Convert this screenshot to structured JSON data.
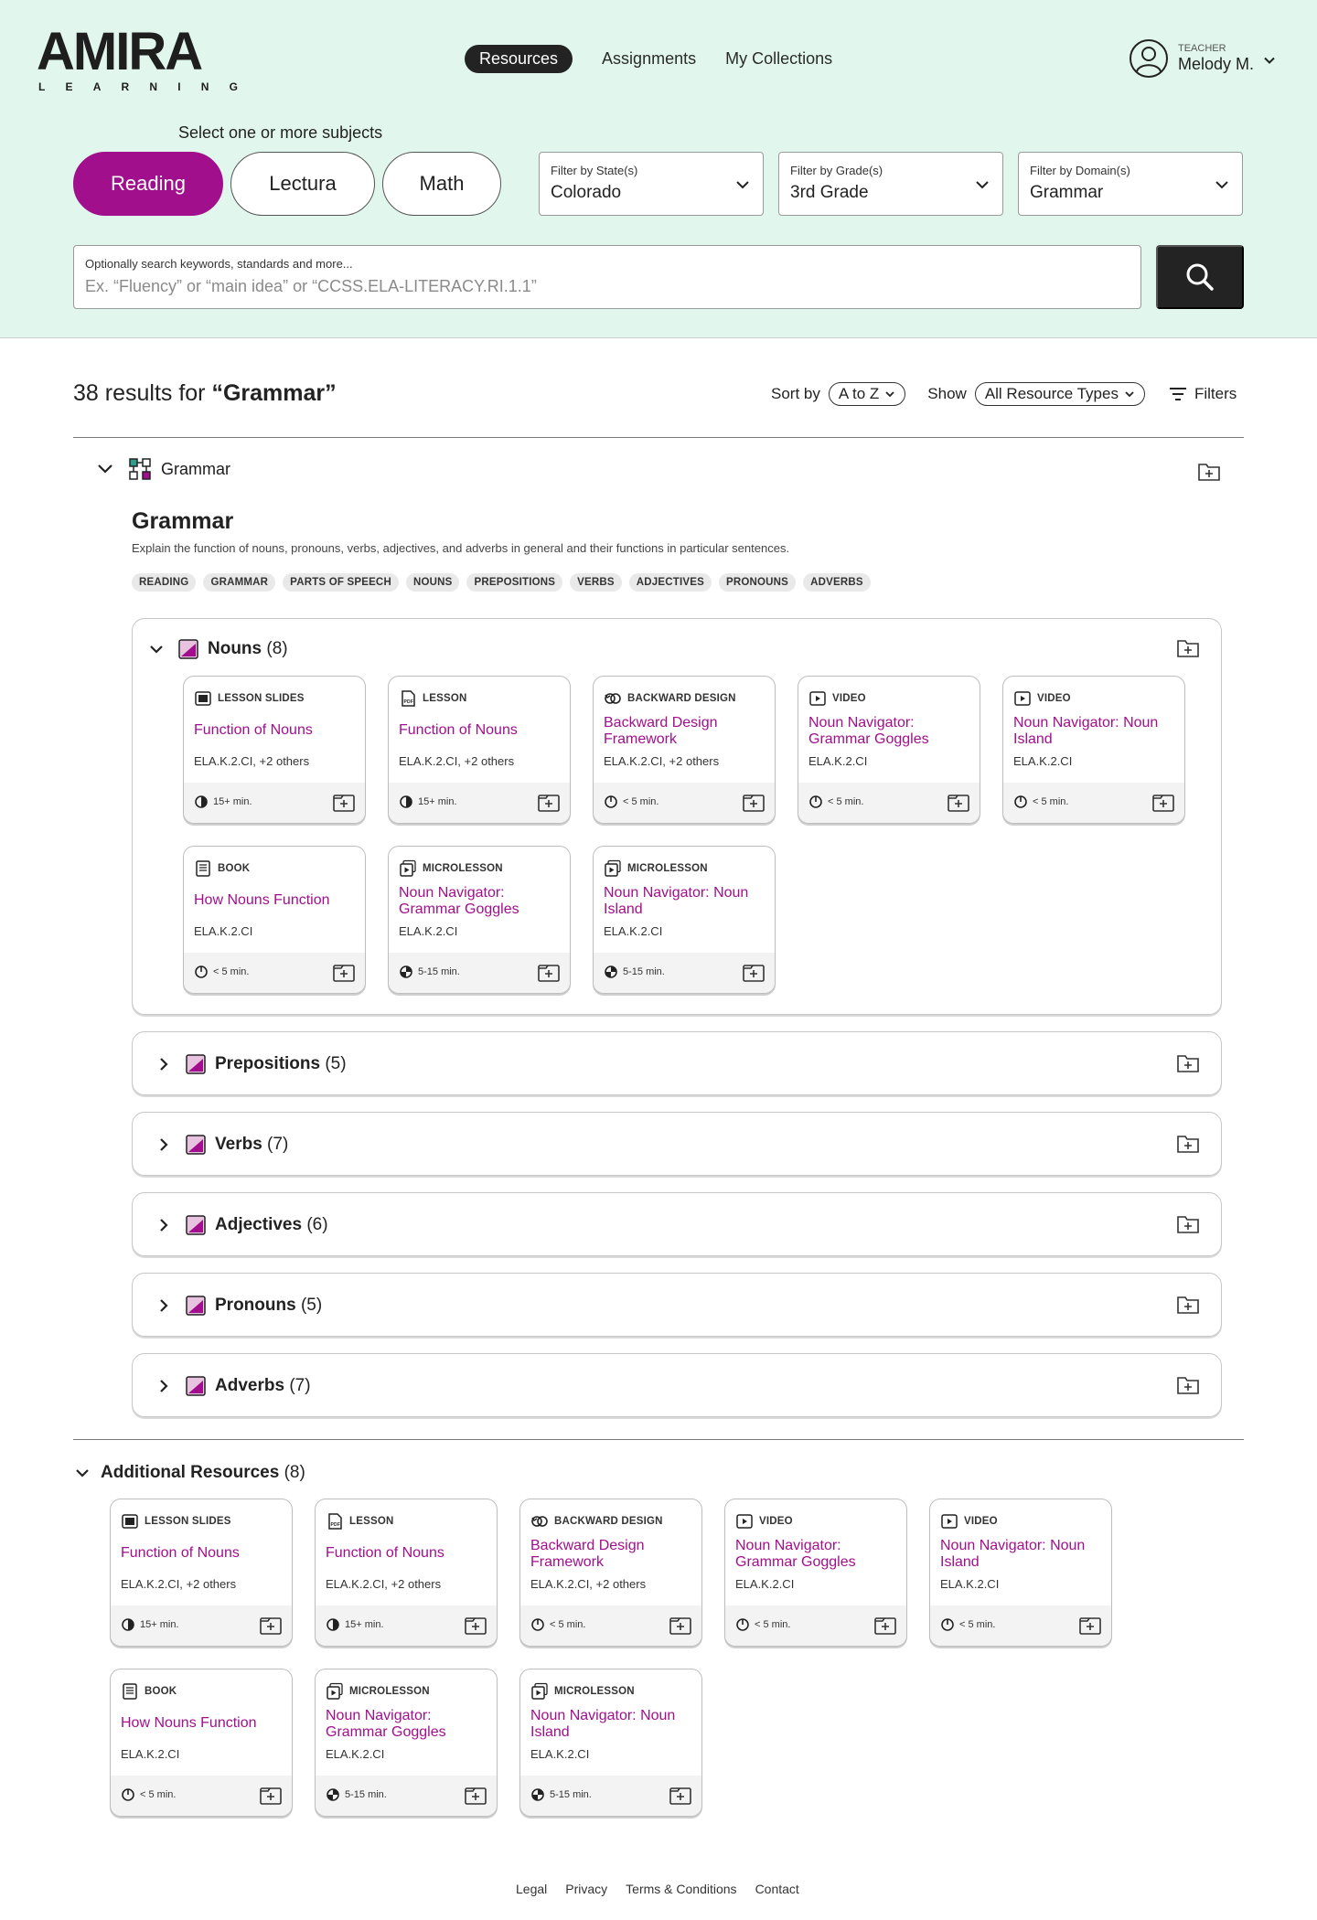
{
  "brand": {
    "name": "AMIRA",
    "sub": [
      "L",
      "E",
      "A",
      "R",
      "N",
      "I",
      "N",
      "G"
    ]
  },
  "nav": [
    {
      "label": "Resources",
      "active": true
    },
    {
      "label": "Assignments"
    },
    {
      "label": "My Collections"
    }
  ],
  "user": {
    "role": "TEACHER",
    "name": "Melody M."
  },
  "subjects": {
    "label": "Select one or more subjects",
    "items": [
      "Reading",
      "Lectura",
      "Math"
    ],
    "active": "Reading"
  },
  "filters": [
    {
      "label": "Filter by State(s)",
      "value": "Colorado"
    },
    {
      "label": "Filter by Grade(s)",
      "value": "3rd Grade"
    },
    {
      "label": "Filter by Domain(s)",
      "value": "Grammar"
    }
  ],
  "search": {
    "label": "Optionally search keywords, standards and more...",
    "placeholder": "Ex. “Fluency” or “main idea” or “CCSS.ELA-LITERACY.RI.1.1”"
  },
  "results": {
    "count_text": "38 results for",
    "query": "“Grammar”"
  },
  "sort": {
    "label": "Sort by",
    "value": "A to Z",
    "show_label": "Show",
    "show_value": "All Resource Types",
    "filters_label": "Filters"
  },
  "domain": {
    "name": "Grammar",
    "title": "Grammar",
    "description": "Explain the function of nouns, pronouns, verbs, adjectives, and adverbs in general and their functions in particular sentences.",
    "tags": [
      "READING",
      "GRAMMAR",
      "PARTS OF SPEECH",
      "NOUNS",
      "PREPOSITIONS",
      "VERBS",
      "ADJECTIVES",
      "PRONOUNS",
      "ADVERBS"
    ]
  },
  "clusters": [
    {
      "name": "Nouns",
      "count": "(8)"
    },
    {
      "name": "Prepositions",
      "count": "(5)"
    },
    {
      "name": "Verbs",
      "count": "(7)"
    },
    {
      "name": "Adjectives",
      "count": "(6)"
    },
    {
      "name": "Pronouns",
      "count": "(5)"
    },
    {
      "name": "Adverbs",
      "count": "(7)"
    }
  ],
  "resources": [
    {
      "type": "LESSON SLIDES",
      "icon": "slides-icon",
      "title": "Function of Nouns",
      "standard": "ELA.K.2.CI, +2 others",
      "time": "15+ min."
    },
    {
      "type": "LESSON",
      "icon": "pdf-icon",
      "title": "Function of Nouns",
      "standard": "ELA.K.2.CI, +2 others",
      "time": "15+ min."
    },
    {
      "type": "BACKWARD DESIGN",
      "icon": "backward-design-icon",
      "title": "Backward Design Framework",
      "standard": "ELA.K.2.CI, +2 others",
      "time": "< 5 min."
    },
    {
      "type": "VIDEO",
      "icon": "video-icon",
      "title": "Noun Navigator: Grammar Goggles",
      "standard": "ELA.K.2.CI",
      "time": "< 5 min."
    },
    {
      "type": "VIDEO",
      "icon": "video-icon",
      "title": "Noun Navigator: Noun Island",
      "standard": "ELA.K.2.CI",
      "time": "< 5 min."
    },
    {
      "type": "BOOK",
      "icon": "book-icon",
      "title": "How Nouns Function",
      "standard": "ELA.K.2.CI",
      "time": "< 5 min."
    },
    {
      "type": "MICROLESSON",
      "icon": "microlesson-icon",
      "title": "Noun Navigator: Grammar Goggles",
      "standard": "ELA.K.2.CI",
      "time": "5-15 min."
    },
    {
      "type": "MICROLESSON",
      "icon": "microlesson-icon",
      "title": "Noun Navigator: Noun Island",
      "standard": "ELA.K.2.CI",
      "time": "5-15 min."
    }
  ],
  "additional": {
    "label": "Additional Resources",
    "count": "(8)"
  },
  "footer": [
    "Legal",
    "Privacy",
    "Terms & Conditions",
    "Contact"
  ],
  "colors": {
    "accent": "#a10f8c",
    "hero_bg": "#e1f6ec",
    "dark": "#232323"
  }
}
